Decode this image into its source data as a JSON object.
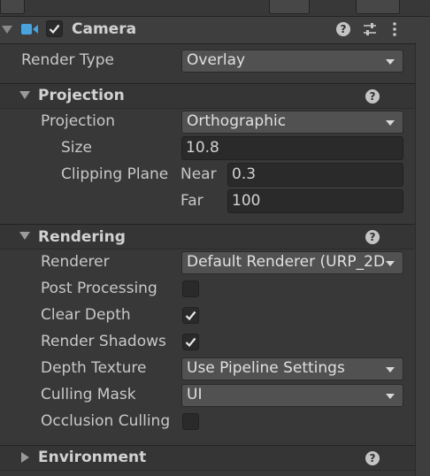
{
  "camera": {
    "title": "Camera",
    "enabled": true,
    "render_type": {
      "label": "Render Type",
      "value": "Overlay"
    }
  },
  "projection": {
    "section": "Projection",
    "projection": {
      "label": "Projection",
      "value": "Orthographic"
    },
    "size": {
      "label": "Size",
      "value": "10.8"
    },
    "clipping": {
      "label": "Clipping Plane",
      "near_label": "Near",
      "near": "0.3",
      "far_label": "Far",
      "far": "100"
    }
  },
  "rendering": {
    "section": "Rendering",
    "renderer": {
      "label": "Renderer",
      "value": "Default Renderer (URP_2D"
    },
    "post_processing": {
      "label": "Post Processing",
      "checked": false
    },
    "clear_depth": {
      "label": "Clear Depth",
      "checked": true
    },
    "render_shadows": {
      "label": "Render Shadows",
      "checked": true
    },
    "depth_texture": {
      "label": "Depth Texture",
      "value": "Use Pipeline Settings"
    },
    "culling_mask": {
      "label": "Culling Mask",
      "value": "UI"
    },
    "occlusion_culling": {
      "label": "Occlusion Culling",
      "checked": false
    }
  },
  "environment": {
    "section": "Environment"
  },
  "icons": {
    "camera": "video-camera-icon",
    "help": "question-mark-icon",
    "presets": "sliders-icon",
    "menu": "kebab-menu-icon",
    "check": "checkmark-icon"
  },
  "colors": {
    "accent": "#4aa3df",
    "background": "#383838"
  }
}
